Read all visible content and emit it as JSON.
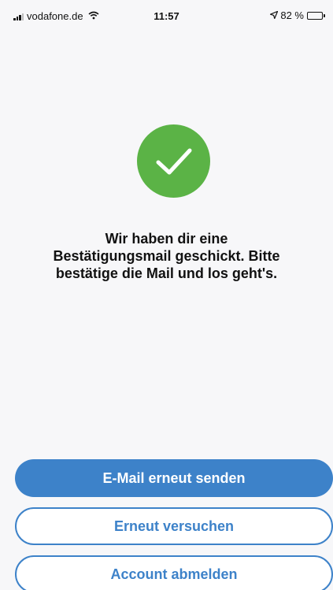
{
  "status_bar": {
    "carrier": "vodafone.de",
    "time": "11:57",
    "battery": "82 %",
    "battery_level": 0.82
  },
  "confirmation": {
    "message_lines": [
      "Wir haben dir eine",
      "Bestätigungsmail geschickt. Bitte",
      "bestätige die Mail und los geht's."
    ],
    "icon": "checkmark-icon",
    "accent_color": "#5bb346"
  },
  "actions": {
    "resend_label": "E-Mail erneut senden",
    "retry_label": "Erneut versuchen",
    "logout_label": "Account abmelden",
    "brand_color": "#3d82c9"
  }
}
